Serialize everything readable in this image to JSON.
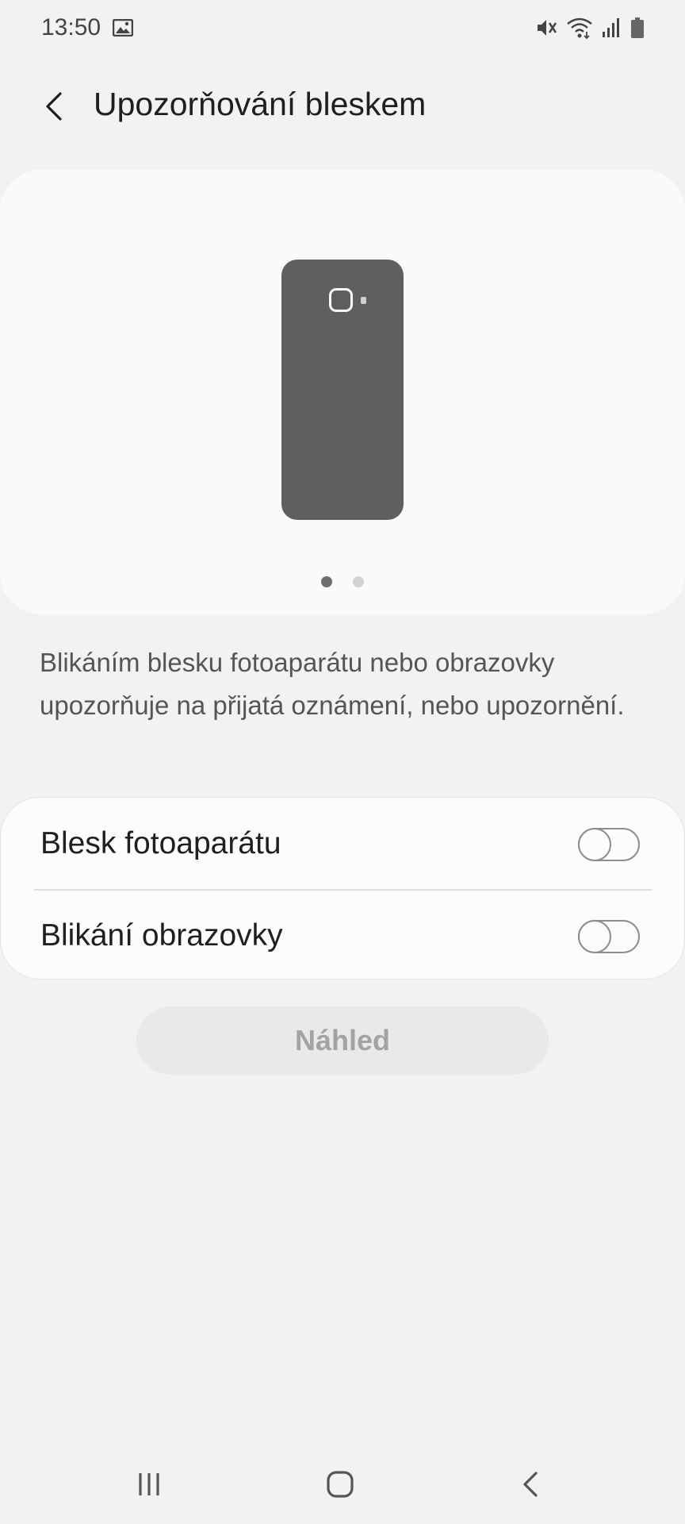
{
  "status_bar": {
    "time": "13:50",
    "icons": [
      "gallery-icon",
      "mute-icon",
      "wifi-icon",
      "signal-icon",
      "battery-icon"
    ]
  },
  "app_bar": {
    "title": "Upozorňování bleskem",
    "back_icon": "back-arrow-icon"
  },
  "illustration": {
    "pages": 2,
    "active_page": 1
  },
  "description": "Blikáním blesku fotoaparátu nebo obrazovky upozorňuje na přijatá oznámení, nebo upozornění.",
  "settings": [
    {
      "label": "Blesk fotoaparátu",
      "enabled": false
    },
    {
      "label": "Blikání obrazovky",
      "enabled": false
    }
  ],
  "preview_button": {
    "label": "Náhled",
    "enabled": false
  },
  "nav_bar": {
    "icons": [
      "recents-icon",
      "home-icon",
      "back-icon"
    ]
  },
  "colors": {
    "background": "#f2f2f2",
    "card": "#fafafa",
    "phone": "#5f5f5f",
    "toggle_off": "#8c8c8c",
    "button_disabled_text": "#a3a3a3"
  }
}
